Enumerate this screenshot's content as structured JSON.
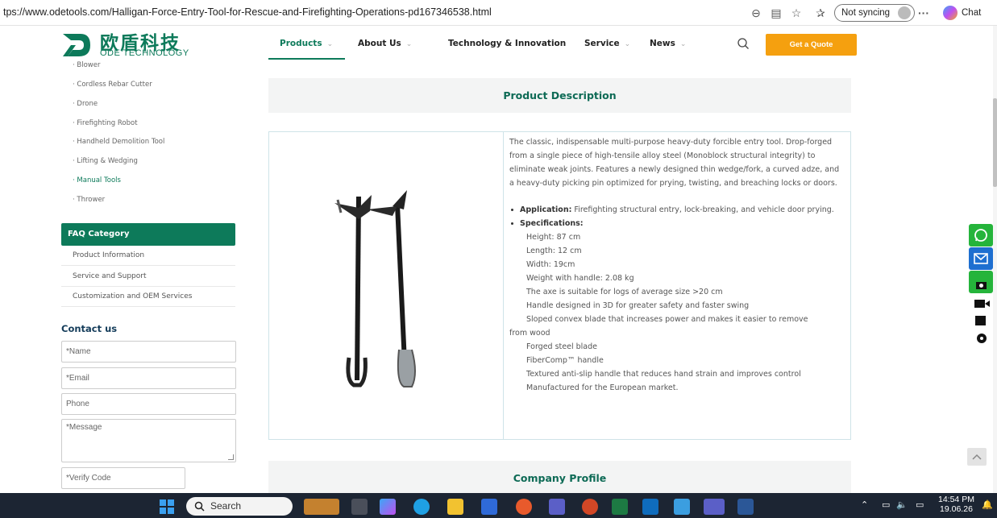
{
  "browser": {
    "url": "tps://www.odetools.com/Halligan-Force-Entry-Tool-for-Rescue-and-Firefighting-Operations-pd167346538.html",
    "sync_label": "Not syncing",
    "more_label": "···",
    "chat_label": "Chat"
  },
  "header": {
    "logo_cn": "欧盾科技",
    "logo_en": "ODE TECHNOLOGY",
    "nav": [
      {
        "label": "Products",
        "active": true
      },
      {
        "label": "About Us"
      },
      {
        "label": "Technology & Innovation"
      },
      {
        "label": "Service"
      },
      {
        "label": "News"
      }
    ],
    "quote_button": "Get a Quote",
    "accent_color": "#0d7a5a",
    "button_color": "#f5a00f"
  },
  "sidebar": {
    "categories": [
      "Blower",
      "Cordless Rebar Cutter",
      "Drone",
      "Firefighting Robot",
      "Handheld Demolition Tool",
      "Lifting & Wedging",
      "Manual Tools",
      "Thrower"
    ],
    "active_category": "Manual Tools",
    "faq_title": "FAQ Category",
    "faq_items": [
      "Product Information",
      "Service and Support",
      "Customization and OEM Services"
    ],
    "contact_title": "Contact us",
    "form": {
      "name": "*Name",
      "email": "*Email",
      "phone": "Phone",
      "message": "*Message",
      "verify": "*Verify Code"
    }
  },
  "main": {
    "description_title": "Product Description",
    "intro": "The classic, indispensable multi-purpose heavy-duty forcible entry tool. Drop-forged from a single piece of high-tensile alloy steel (Monoblock structural integrity) to eliminate weak joints. Features a newly designed thin wedge/fork, a curved adze, and a heavy-duty picking pin optimized for prying, twisting, and breaching locks or doors.",
    "application_label": "Application:",
    "application_text": " Firefighting structural entry, lock-breaking, and vehicle door prying.",
    "specs_label": "Specifications:",
    "specs": [
      "Height: 87 cm",
      "Length: 12 cm",
      "Width: 19cm",
      "Weight with handle: 2.08 kg",
      "The axe is suitable for logs of average size >20 cm",
      "Handle designed in 3D for greater safety and faster swing",
      "Sloped convex blade that increases power and makes it easier to remove",
      "from wood",
      "Forged steel blade",
      "FiberComp™ handle",
      "Textured anti-slip handle that reduces hand strain and improves control",
      "Manufactured for the European market."
    ],
    "company_title": "Company Profile"
  },
  "taskbar": {
    "search_label": "Search",
    "time": "14:54 PM",
    "date": "19.06.26"
  }
}
